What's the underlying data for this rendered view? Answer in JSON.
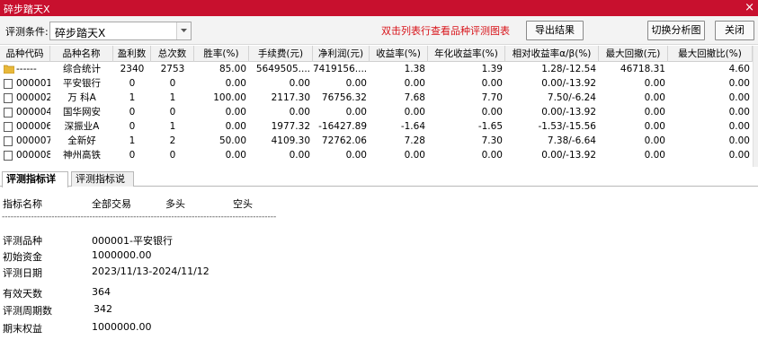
{
  "window": {
    "title": "碎步踏天X",
    "close_glyph": "×"
  },
  "toolbar": {
    "condition_label": "评测条件:",
    "condition_value": "碎步踏天X",
    "hint": "双击列表行查看品种评测图表",
    "export_label": "导出结果",
    "switch_label": "切换分析图",
    "close_label": "关闭"
  },
  "table": {
    "headers": [
      "品种代码",
      "品种名称",
      "盈利数",
      "总次数",
      "胜率(%)",
      "手续费(元)",
      "净利润(元)",
      "收益率(%)",
      "年化收益率(%)",
      "相对收益率α/β(%)",
      "最大回撤(元)",
      "最大回撤比(%)"
    ],
    "rows": [
      {
        "icon": "folder-icon",
        "code": "------",
        "name": "综合统计",
        "win": "2340",
        "total": "2753",
        "rate": "85.00",
        "fee": "5649505....",
        "profit": "7419156....",
        "ret": "1.38",
        "annual": "1.39",
        "rel": "1.28/-12.54",
        "mdd": "46718.31",
        "mddr": "4.60"
      },
      {
        "icon": "document-icon",
        "code": "000001",
        "name": "平安银行",
        "win": "0",
        "total": "0",
        "rate": "0.00",
        "fee": "0.00",
        "profit": "0.00",
        "ret": "0.00",
        "annual": "0.00",
        "rel": "0.00/-13.92",
        "mdd": "0.00",
        "mddr": "0.00"
      },
      {
        "icon": "document-icon",
        "code": "000002",
        "name": "万 科A",
        "win": "1",
        "total": "1",
        "rate": "100.00",
        "fee": "2117.30",
        "profit": "76756.32",
        "ret": "7.68",
        "annual": "7.70",
        "rel": "7.50/-6.24",
        "mdd": "0.00",
        "mddr": "0.00"
      },
      {
        "icon": "document-icon",
        "code": "000004",
        "name": "国华网安",
        "win": "0",
        "total": "0",
        "rate": "0.00",
        "fee": "0.00",
        "profit": "0.00",
        "ret": "0.00",
        "annual": "0.00",
        "rel": "0.00/-13.92",
        "mdd": "0.00",
        "mddr": "0.00"
      },
      {
        "icon": "document-icon",
        "code": "000006",
        "name": "深振业A",
        "win": "0",
        "total": "1",
        "rate": "0.00",
        "fee": "1977.32",
        "profit": "-16427.89",
        "ret": "-1.64",
        "annual": "-1.65",
        "rel": "-1.53/-15.56",
        "mdd": "0.00",
        "mddr": "0.00"
      },
      {
        "icon": "document-icon",
        "code": "000007",
        "name": "全新好",
        "win": "1",
        "total": "2",
        "rate": "50.00",
        "fee": "4109.30",
        "profit": "72762.06",
        "ret": "7.28",
        "annual": "7.30",
        "rel": "7.38/-6.64",
        "mdd": "0.00",
        "mddr": "0.00"
      },
      {
        "icon": "document-icon",
        "code": "000008",
        "name": "神州高铁",
        "win": "0",
        "total": "0",
        "rate": "0.00",
        "fee": "0.00",
        "profit": "0.00",
        "ret": "0.00",
        "annual": "0.00",
        "rel": "0.00/-13.92",
        "mdd": "0.00",
        "mddr": "0.00"
      }
    ]
  },
  "tabs": [
    "评测指标详情",
    "评测指标说明"
  ],
  "detail": {
    "headers": [
      "指标名称",
      "全部交易",
      "多头",
      "空头"
    ],
    "separator": "----------------------------------------------------------------------------------------------",
    "items": [
      {
        "label": "评测品种",
        "value": "000001-平安银行"
      },
      {
        "label": "初始资金",
        "value": "1000000.00"
      },
      {
        "label": "评测日期",
        "value": "2023/11/13-2024/11/12"
      },
      {
        "label": "有效天数",
        "value": "364"
      },
      {
        "label": "评测周期数",
        "value": "342"
      },
      {
        "label": "期末权益",
        "value": "1000000.00"
      }
    ]
  },
  "colors": {
    "titlebar": "#c8102e",
    "hint": "#d8141a"
  }
}
